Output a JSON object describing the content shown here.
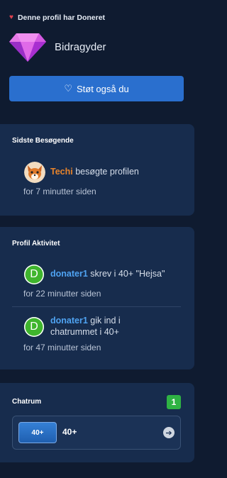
{
  "profile": {
    "donated_text": "Denne profil har Doneret",
    "badge_label": "Bidragyder",
    "support_button": "Støt også du"
  },
  "recent_visitors": {
    "title": "Sidste Besøgende",
    "items": [
      {
        "name": "Techi",
        "action": "besøgte profilen",
        "time": "for 7 minutter siden"
      }
    ]
  },
  "profile_activity": {
    "title": "Profil Aktivitet",
    "items": [
      {
        "avatar_letter": "D",
        "user": "donater1",
        "line1": "skrev i 40+ \"Hejsa\"",
        "line2": "",
        "time": "for 22 minutter siden"
      },
      {
        "avatar_letter": "D",
        "user": "donater1",
        "line1": "gik ind i",
        "line2": "chatrummet i 40+",
        "time": "for 47 minutter siden"
      }
    ]
  },
  "chatrooms": {
    "title": "Chatrum",
    "count": "1",
    "rooms": [
      {
        "thumb_label": "40+",
        "name": "40+"
      }
    ]
  },
  "colors": {
    "background": "#0f1b30",
    "card": "#172c4d",
    "accent_blue": "#2a6fce",
    "visitor_name": "#e8842b",
    "user_link": "#4fa3f2",
    "avatar_green": "#3fb52d",
    "badge_green": "#2fb344"
  }
}
